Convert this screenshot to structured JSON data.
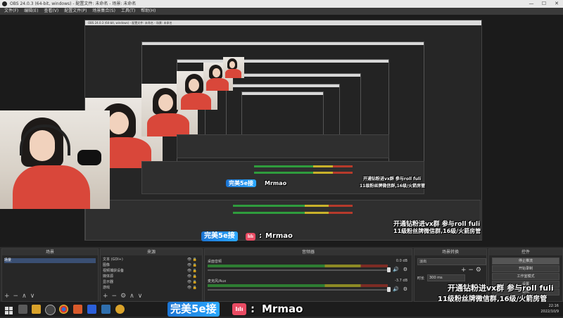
{
  "window": {
    "title": "OBS 24.0.3 (64-bit, windows) - 配置文件: 未命名 - 场景: 未命名",
    "controls": [
      "—",
      "☐",
      "✕"
    ]
  },
  "menu": [
    "文件(F)",
    "编辑(E)",
    "查看(V)",
    "配置文件(P)",
    "场景集合(S)",
    "工具(T)",
    "帮助(H)"
  ],
  "overlay": {
    "vx_line": "开通钻粉进vx群 参与roll fuli",
    "fans_line": "11级粉丝牌微信群,16级/火箭房管",
    "banner": "完美5e接",
    "logo": "lılı",
    "colon": ":",
    "streamer": "Mrmao"
  },
  "docks": {
    "scenes": {
      "title": "场景",
      "items": [
        "场景"
      ]
    },
    "sources": {
      "title": "来源",
      "items": [
        "文本 (GDI+)",
        "图像",
        "视频捕获设备",
        "媒体源",
        "显示器",
        "游戏"
      ]
    },
    "mixer": {
      "title": "音频器",
      "tracks": [
        {
          "name": "桌面音频",
          "db": "0.0 dB"
        },
        {
          "name": "麦克风/Aux",
          "db": "-3.7 dB"
        }
      ]
    },
    "transitions": {
      "title": "场景转换",
      "selected": "淡出",
      "duration_label": "时长",
      "duration_value": "300 ms"
    },
    "controls": {
      "title": "控件",
      "buttons": [
        "停止推流",
        "开始录制",
        "工作室模式",
        "设置",
        "退出"
      ]
    },
    "footer_icons": [
      "+",
      "−",
      "∧",
      "∨"
    ],
    "source_footer_icons": [
      "+",
      "−",
      "⚙",
      "∧",
      "∨"
    ]
  },
  "taskbar": {
    "time": "22:16",
    "date": "2022/10/9"
  }
}
